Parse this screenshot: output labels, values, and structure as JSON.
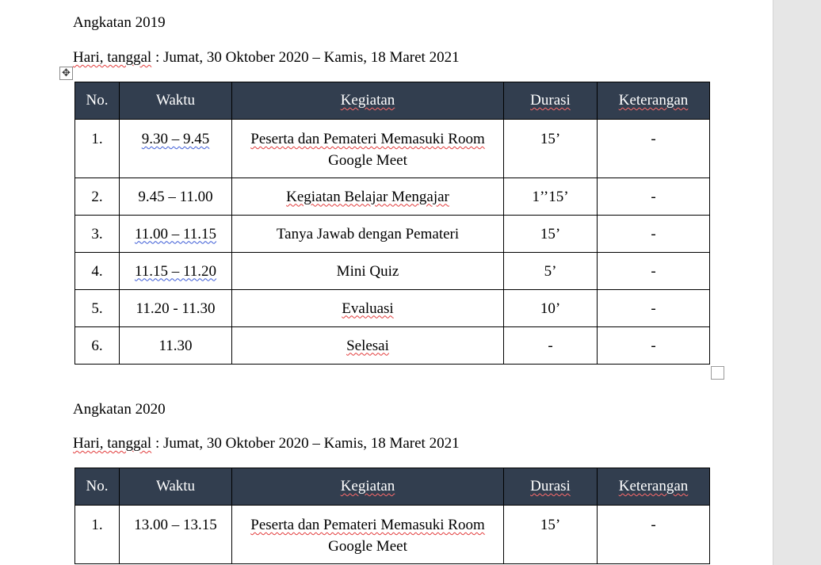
{
  "sections": [
    {
      "heading": "Angkatan 2019",
      "date_line_label": "Hari, tanggal",
      "date_line_sep": " : ",
      "date_line_value": "Jumat, 30 Oktober 2020 – Kamis, 18 Maret 2021",
      "columns": [
        "No.",
        "Waktu",
        "Kegiatan",
        "Durasi",
        "Keterangan"
      ],
      "rows": [
        {
          "no": "1.",
          "waktu": "9.30  –  9.45",
          "kegiatan_l1": "Peserta dan Pemateri Memasuki Room",
          "kegiatan_l2": "Google Meet",
          "durasi": "15’",
          "keterangan": "-"
        },
        {
          "no": "2.",
          "waktu": "9.45 – 11.00",
          "kegiatan": "Kegiatan Belajar Mengajar",
          "durasi": "1’’15’",
          "keterangan": "-"
        },
        {
          "no": "3.",
          "waktu": "11.00  – 11.15",
          "kegiatan": "Tanya Jawab dengan Pemateri",
          "durasi": "15’",
          "keterangan": "-"
        },
        {
          "no": "4.",
          "waktu": "11.15  –  11.20",
          "kegiatan": "Mini Quiz",
          "durasi": "5’",
          "keterangan": "-"
        },
        {
          "no": "5.",
          "waktu": "11.20 - 11.30",
          "kegiatan": "Evaluasi",
          "durasi": "10’",
          "keterangan": "-"
        },
        {
          "no": "6.",
          "waktu": "11.30",
          "kegiatan": "Selesai",
          "durasi": "-",
          "keterangan": "-"
        }
      ]
    },
    {
      "heading": "Angkatan 2020",
      "date_line_label": "Hari, tanggal",
      "date_line_sep": " : ",
      "date_line_value": "Jumat, 30 Oktober 2020 – Kamis, 18 Maret 2021",
      "columns": [
        "No.",
        "Waktu",
        "Kegiatan",
        "Durasi",
        "Keterangan"
      ],
      "rows": [
        {
          "no": "1.",
          "waktu": "13.00 – 13.15",
          "kegiatan_l1": "Peserta dan Pemateri Memasuki Room",
          "kegiatan_l2": "Google Meet",
          "durasi": "15’",
          "keterangan": "-"
        }
      ]
    }
  ],
  "icons": {
    "move_handle": "move-arrows-icon",
    "resize_handle": "resize-square-icon"
  },
  "colors": {
    "header_bg": "#323e4f",
    "header_text": "#ffffff",
    "spell_error": "#e23b3b",
    "grammar": "#3b5bd6"
  }
}
